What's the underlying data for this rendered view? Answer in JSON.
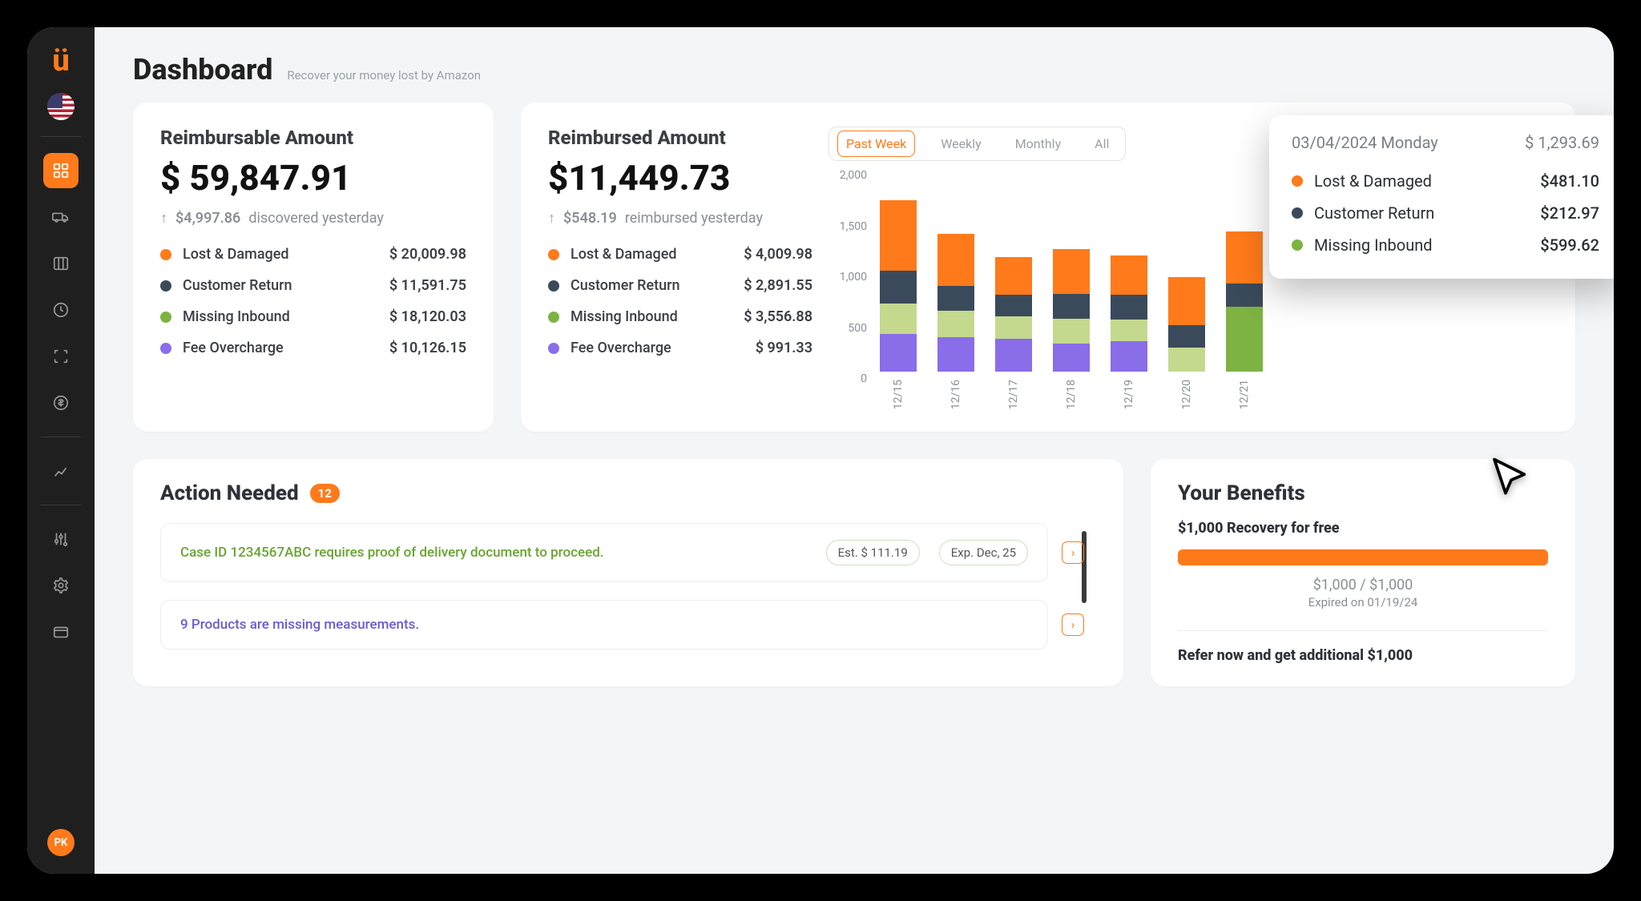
{
  "header": {
    "title": "Dashboard",
    "subtitle": "Recover your money lost by Amazon"
  },
  "sidebar": {
    "avatar_initials": "PK",
    "items": [
      {
        "name": "dashboard"
      },
      {
        "name": "shipments"
      },
      {
        "name": "reports"
      },
      {
        "name": "pending"
      },
      {
        "name": "scan"
      },
      {
        "name": "money"
      },
      {
        "name": "analytics"
      },
      {
        "name": "settings-sliders"
      },
      {
        "name": "settings-gear"
      },
      {
        "name": "cards"
      }
    ]
  },
  "colors": {
    "lost_damaged": "#ff7a1a",
    "customer_return": "#3a4a5a",
    "missing_inbound": "#7cb342",
    "fee_overcharge": "#8a6de9"
  },
  "reimbursable": {
    "title": "Reimbursable Amount",
    "amount": "$ 59,847.91",
    "delta_value": "$4,997.86",
    "delta_label": "discovered yesterday",
    "breakdown": [
      {
        "label": "Lost & Damaged",
        "value": "$ 20,009.98",
        "color": "c-orange"
      },
      {
        "label": "Customer Return",
        "value": "$ 11,591.75",
        "color": "c-dblue"
      },
      {
        "label": "Missing Inbound",
        "value": "$ 18,120.03",
        "color": "c-green"
      },
      {
        "label": "Fee Overcharge",
        "value": "$ 10,126.15",
        "color": "c-purple"
      }
    ]
  },
  "reimbursed": {
    "title": "Reimbursed Amount",
    "amount": "$11,449.73",
    "delta_value": "$548.19",
    "delta_label": "reimbursed yesterday",
    "breakdown": [
      {
        "label": "Lost & Damaged",
        "value": "$ 4,009.98",
        "color": "c-orange"
      },
      {
        "label": "Customer Return",
        "value": "$ 2,891.55",
        "color": "c-dblue"
      },
      {
        "label": "Missing Inbound",
        "value": "$ 3,556.88",
        "color": "c-green"
      },
      {
        "label": "Fee Overcharge",
        "value": "$ 991.33",
        "color": "c-purple"
      }
    ]
  },
  "chart_tabs": [
    "Past Week",
    "Weekly",
    "Monthly",
    "All"
  ],
  "chart_active_tab": "Past Week",
  "chart_data": {
    "type": "bar",
    "stacked": true,
    "ylabel": "",
    "xlabel": "",
    "ylim": [
      0,
      2000
    ],
    "y_ticks": [
      "2,000",
      "1,500",
      "1,000",
      "500",
      "0"
    ],
    "categories": [
      "12/15",
      "12/16",
      "12/17",
      "12/18",
      "12/19",
      "12/20",
      "12/21"
    ],
    "series": [
      {
        "name": "Fee Overcharge",
        "color": "#8a6de9",
        "values": [
          350,
          320,
          300,
          260,
          280,
          0,
          0
        ]
      },
      {
        "name": "Missing Inbound (light)",
        "color": "#c4d98e",
        "values": [
          280,
          240,
          210,
          230,
          200,
          220,
          0
        ]
      },
      {
        "name": "Missing Inbound",
        "color": "#7cb342",
        "values": [
          0,
          0,
          0,
          0,
          0,
          0,
          600
        ]
      },
      {
        "name": "Customer Return",
        "color": "#3a4a5a",
        "values": [
          300,
          230,
          200,
          230,
          230,
          210,
          213
        ]
      },
      {
        "name": "Lost & Damaged",
        "color": "#ff7a1a",
        "values": [
          650,
          480,
          350,
          410,
          360,
          440,
          481
        ]
      }
    ]
  },
  "tooltip": {
    "date": "03/04/2024 Monday",
    "total": "$ 1,293.69",
    "rows": [
      {
        "label": "Lost & Damaged",
        "value": "$481.10",
        "color": "c-orange"
      },
      {
        "label": "Customer Return",
        "value": "$212.97",
        "color": "c-dblue"
      },
      {
        "label": "Missing Inbound",
        "value": "$599.62",
        "color": "c-green"
      }
    ]
  },
  "actions": {
    "title": "Action Needed",
    "count": "12",
    "items": [
      {
        "text": "Case ID 1234567ABC requires proof of delivery document to proceed.",
        "style": "green",
        "est": "Est. $ 111.19",
        "exp": "Exp. Dec, 25"
      },
      {
        "text": "9 Products are missing measurements.",
        "style": "purple"
      }
    ]
  },
  "benefits": {
    "title": "Your Benefits",
    "subtitle": "$1,000 Recovery for free",
    "progress_text": "$1,000 / $1,000",
    "progress_pct": 100,
    "expired_text": "Expired on 01/19/24",
    "refer_text": "Refer now and get additional $1,000"
  }
}
